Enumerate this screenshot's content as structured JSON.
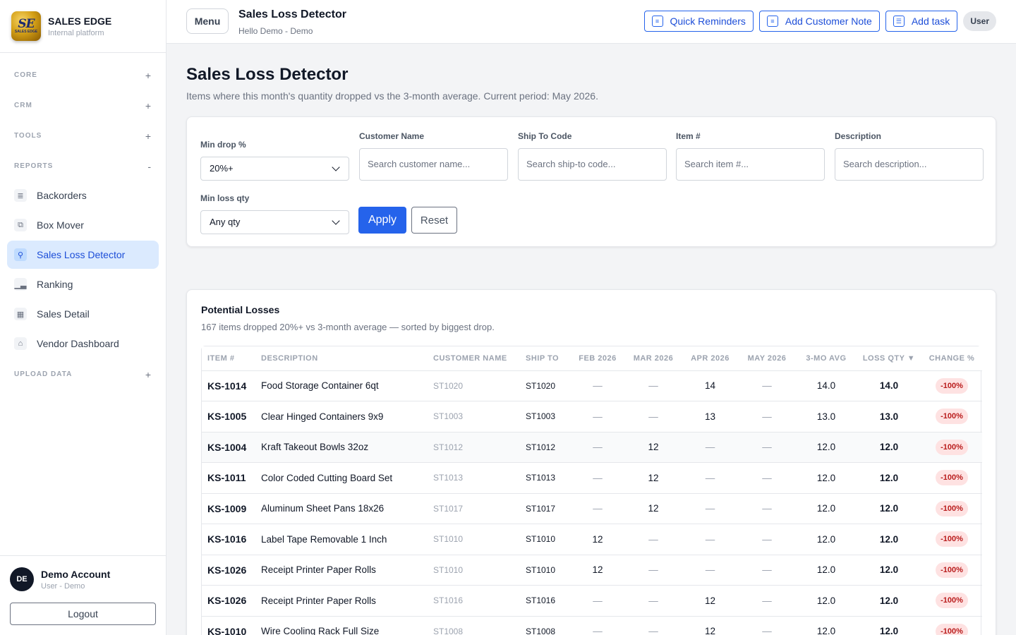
{
  "brand": {
    "title": "SALES EDGE",
    "subtitle": "Internal platform",
    "logo_text": "SE",
    "logo_small": "SALES EDGE"
  },
  "sidebar": {
    "sections": [
      {
        "label": "CORE",
        "toggle": "+"
      },
      {
        "label": "CRM",
        "toggle": "+"
      },
      {
        "label": "TOOLS",
        "toggle": "+"
      },
      {
        "label": "REPORTS",
        "toggle": "-"
      },
      {
        "label": "UPLOAD DATA",
        "toggle": "+"
      }
    ],
    "items": [
      {
        "label": "Backorders",
        "icon": "document-list-icon"
      },
      {
        "label": "Box Mover",
        "icon": "boxes-icon"
      },
      {
        "label": "Sales Loss Detector",
        "icon": "magnifier-icon",
        "active": true
      },
      {
        "label": "Ranking",
        "icon": "bar-chart-icon"
      },
      {
        "label": "Sales Detail",
        "icon": "grid-icon"
      },
      {
        "label": "Vendor Dashboard",
        "icon": "home-icon"
      }
    ]
  },
  "account": {
    "initials": "DE",
    "name": "Demo Account",
    "role": "User - Demo",
    "logout": "Logout"
  },
  "topbar": {
    "menu": "Menu",
    "title": "Sales Loss Detector",
    "subtitle": "Hello Demo - Demo",
    "actions": [
      "Quick Reminders",
      "Add Customer Note",
      "Add task"
    ],
    "user": "User"
  },
  "page": {
    "title": "Sales Loss Detector",
    "description": "Items where this month's quantity dropped vs the 3-month average. Current period: May 2026."
  },
  "filters": {
    "min_drop_label": "Min drop %",
    "min_drop_value": "20%+",
    "customer_label": "Customer Name",
    "customer_placeholder": "Search customer name...",
    "ship_label": "Ship To Code",
    "ship_placeholder": "Search ship-to code...",
    "item_label": "Item #",
    "item_placeholder": "Search item #...",
    "desc_label": "Description",
    "desc_placeholder": "Search description...",
    "min_loss_label": "Min loss qty",
    "min_loss_value": "Any qty",
    "apply": "Apply",
    "reset": "Reset"
  },
  "losses": {
    "title": "Potential Losses",
    "subtitle": "167 items dropped 20%+ vs 3-month average — sorted by biggest drop.",
    "columns": [
      "ITEM #",
      "DESCRIPTION",
      "CUSTOMER NAME",
      "SHIP TO",
      "FEB 2026",
      "MAR 2026",
      "APR 2026",
      "MAY 2026",
      "3-MO AVG",
      "LOSS QTY ▼",
      "CHANGE %"
    ],
    "rows": [
      {
        "item": "KS-1014",
        "desc": "Food Storage Container 6qt",
        "cust": "ST1020",
        "ship": "ST1020",
        "feb": "—",
        "mar": "—",
        "apr": "14",
        "may": "—",
        "avg": "14.0",
        "loss": "14.0",
        "change": "-100%"
      },
      {
        "item": "KS-1005",
        "desc": "Clear Hinged Containers 9x9",
        "cust": "ST1003",
        "ship": "ST1003",
        "feb": "—",
        "mar": "—",
        "apr": "13",
        "may": "—",
        "avg": "13.0",
        "loss": "13.0",
        "change": "-100%"
      },
      {
        "item": "KS-1004",
        "desc": "Kraft Takeout Bowls 32oz",
        "cust": "ST1012",
        "ship": "ST1012",
        "feb": "—",
        "mar": "12",
        "apr": "—",
        "may": "—",
        "avg": "12.0",
        "loss": "12.0",
        "change": "-100%"
      },
      {
        "item": "KS-1011",
        "desc": "Color Coded Cutting Board Set",
        "cust": "ST1013",
        "ship": "ST1013",
        "feb": "—",
        "mar": "12",
        "apr": "—",
        "may": "—",
        "avg": "12.0",
        "loss": "12.0",
        "change": "-100%"
      },
      {
        "item": "KS-1009",
        "desc": "Aluminum Sheet Pans 18x26",
        "cust": "ST1017",
        "ship": "ST1017",
        "feb": "—",
        "mar": "12",
        "apr": "—",
        "may": "—",
        "avg": "12.0",
        "loss": "12.0",
        "change": "-100%"
      },
      {
        "item": "KS-1016",
        "desc": "Label Tape Removable 1 Inch",
        "cust": "ST1010",
        "ship": "ST1010",
        "feb": "12",
        "mar": "—",
        "apr": "—",
        "may": "—",
        "avg": "12.0",
        "loss": "12.0",
        "change": "-100%"
      },
      {
        "item": "KS-1026",
        "desc": "Receipt Printer Paper Rolls",
        "cust": "ST1010",
        "ship": "ST1010",
        "feb": "12",
        "mar": "—",
        "apr": "—",
        "may": "—",
        "avg": "12.0",
        "loss": "12.0",
        "change": "-100%"
      },
      {
        "item": "KS-1026",
        "desc": "Receipt Printer Paper Rolls",
        "cust": "ST1016",
        "ship": "ST1016",
        "feb": "—",
        "mar": "—",
        "apr": "12",
        "may": "—",
        "avg": "12.0",
        "loss": "12.0",
        "change": "-100%"
      },
      {
        "item": "KS-1010",
        "desc": "Wire Cooling Rack Full Size",
        "cust": "ST1008",
        "ship": "ST1008",
        "feb": "—",
        "mar": "—",
        "apr": "12",
        "may": "—",
        "avg": "12.0",
        "loss": "12.0",
        "change": "-100%"
      }
    ]
  }
}
